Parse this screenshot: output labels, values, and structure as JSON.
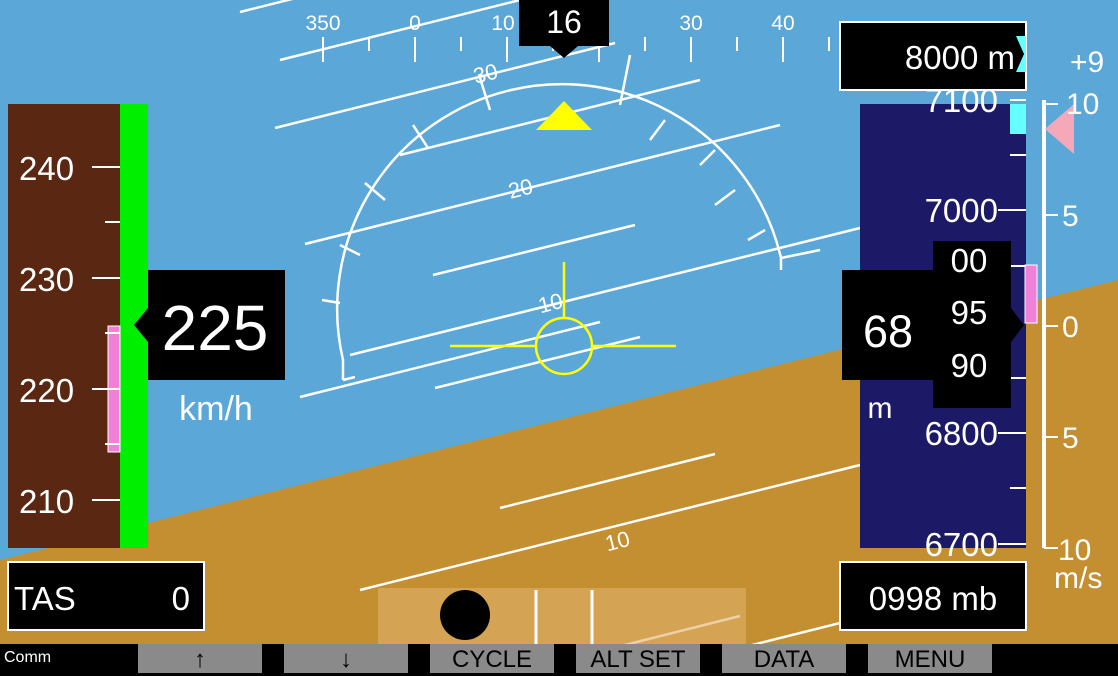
{
  "heading": {
    "current": "16",
    "tape_labels": [
      "350",
      "0",
      "10",
      "30",
      "40"
    ]
  },
  "pitch": {
    "labels": [
      "30",
      "20",
      "10",
      "10"
    ]
  },
  "airspeed": {
    "value": "225",
    "unit": "km/h",
    "tape_labels": [
      "240",
      "230",
      "220",
      "210"
    ],
    "tas_label": "TAS",
    "tas_value": "0"
  },
  "altitude": {
    "big_digits": "68",
    "roll_digits": [
      "00",
      "95",
      "90"
    ],
    "unit": "m",
    "tape_labels": [
      "7100",
      "7000",
      "6800",
      "6700"
    ],
    "selected": "8000 m",
    "baro": "0998 mb"
  },
  "vsi": {
    "top_readout": "+9",
    "labels": [
      "10",
      "5",
      "0",
      "5",
      "10"
    ],
    "unit": "m/s"
  },
  "softkeys": {
    "comm": "Comm",
    "up": "↑",
    "down": "↓",
    "cycle": "CYCLE",
    "alt_set": "ALT SET",
    "data": "DATA",
    "menu": "MENU"
  },
  "colors": {
    "sky": "#5ba7d8",
    "ground": "#c48f31",
    "speed_tape": "#5a2812",
    "alt_tape": "#1c1a66",
    "speed_band": "#00ee00",
    "bug": "#f080d8",
    "aircraft_symbol": "#ffff00"
  }
}
